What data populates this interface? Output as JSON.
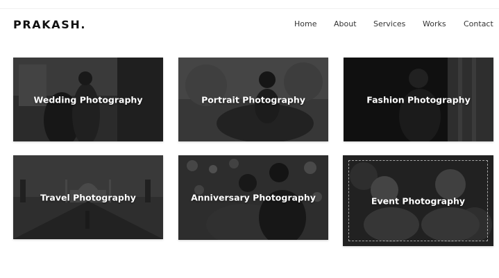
{
  "header": {
    "logo": "PRAKASH.",
    "nav": [
      "Home",
      "About",
      "Services",
      "Works",
      "Contact"
    ]
  },
  "gallery": {
    "items": [
      {
        "label": "Wedding Photography"
      },
      {
        "label": "Portrait Photography"
      },
      {
        "label": "Fashion Photography"
      },
      {
        "label": "Travel Photography"
      },
      {
        "label": "Anniversary Photography"
      },
      {
        "label": "Event Photography"
      }
    ]
  }
}
